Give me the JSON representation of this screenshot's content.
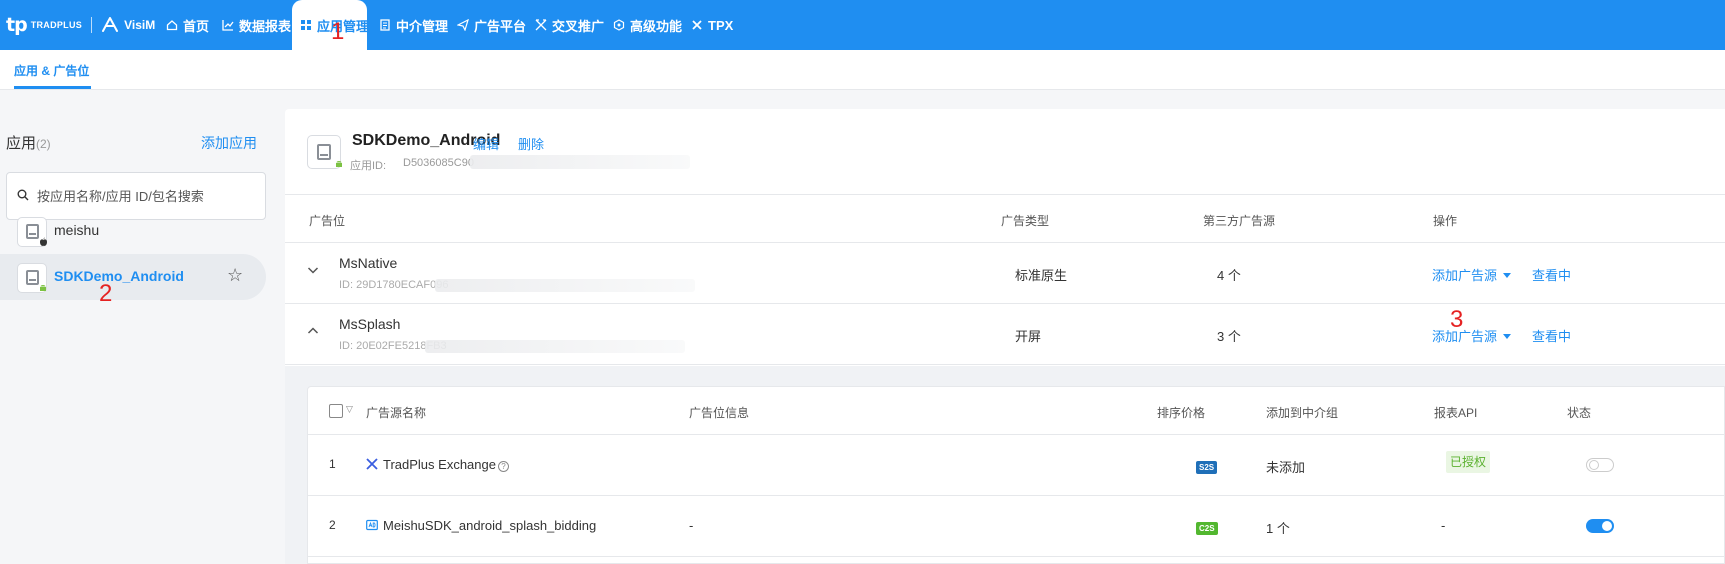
{
  "brand": {
    "logo_mark": "tp",
    "logo_text": "TRADPLUS",
    "partner": "VisiM"
  },
  "nav": [
    {
      "label": "首页",
      "icon": "home-icon"
    },
    {
      "label": "数据报表",
      "icon": "chart-icon"
    },
    {
      "label": "应用管理",
      "icon": "grid-icon",
      "active": true
    },
    {
      "label": "中介管理",
      "icon": "document-icon"
    },
    {
      "label": "广告平台",
      "icon": "send-icon"
    },
    {
      "label": "交叉推广",
      "icon": "crossover-icon"
    },
    {
      "label": "高级功能",
      "icon": "hexagon-icon"
    },
    {
      "label": "TPX",
      "icon": "x-icon"
    }
  ],
  "subtab": "应用 & 广告位",
  "sidebar": {
    "title": "应用",
    "count": "(2)",
    "add_label": "添加应用",
    "search_placeholder": "按应用名称/应用 ID/包名搜索",
    "apps": [
      {
        "name": "meishu",
        "os": "apple-icon"
      },
      {
        "name": "SDKDemo_Android",
        "os": "android-icon",
        "selected": true
      }
    ]
  },
  "app": {
    "title": "SDKDemo_Android",
    "edit_label": "编辑",
    "delete_label": "删除",
    "id_label": "应用ID:",
    "id_value": "D5036085C90"
  },
  "placements": {
    "headers": {
      "name": "广告位",
      "type": "广告类型",
      "sources": "第三方广告源",
      "ops": "操作"
    },
    "rows": [
      {
        "name": "MsNative",
        "id": "ID: 29D1780ECAF096",
        "type": "标准原生",
        "count": "4 个",
        "add": "添加广告源",
        "view": "查看中",
        "expanded": false
      },
      {
        "name": "MsSplash",
        "id": "ID: 20E02FE5218FB3",
        "type": "开屏",
        "count": "3 个",
        "add": "添加广告源",
        "view": "查看中",
        "expanded": true
      }
    ]
  },
  "sources": {
    "headers": {
      "name": "广告源名称",
      "info": "广告位信息",
      "price": "排序价格",
      "group": "添加到中介组",
      "api": "报表API",
      "status": "状态"
    },
    "rows": [
      {
        "index": "1",
        "name": "TradPlus Exchange",
        "info": "",
        "price": "S2S",
        "price_color": "#1f6fb8",
        "group": "未添加",
        "api": "已授权",
        "enabled": false
      },
      {
        "index": "2",
        "name": "MeishuSDK_android_splash_bidding",
        "info": "-",
        "price": "C2S",
        "price_color": "#52b72f",
        "group": "1 个",
        "api": "-",
        "enabled": true
      }
    ]
  },
  "annotations": [
    "1",
    "2",
    "3"
  ],
  "colors": {
    "primary": "#1f8ef1",
    "annotation": "#e52222",
    "authorized": "#5bb12f"
  }
}
